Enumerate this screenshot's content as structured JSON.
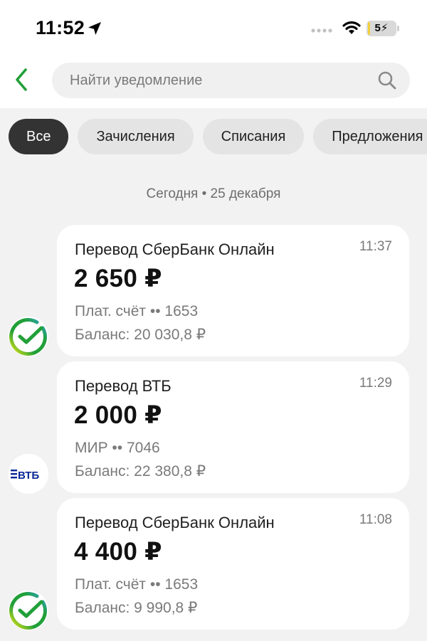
{
  "status_bar": {
    "time": "11:52",
    "battery": "5",
    "battery_level_percent": 5,
    "icons": [
      "location-arrow-icon",
      "cellular-signal-icon",
      "wifi-icon",
      "battery-icon"
    ]
  },
  "header": {
    "back_icon": "chevron-left-icon",
    "search": {
      "placeholder": "Найти уведомление",
      "value": "",
      "icon": "search-icon"
    }
  },
  "filters": [
    {
      "label": "Все",
      "active": true
    },
    {
      "label": "Зачисления",
      "active": false
    },
    {
      "label": "Списания",
      "active": false
    },
    {
      "label": "Предложения",
      "active": false
    }
  ],
  "date_header": "Сегодня • 25 декабря",
  "notifications": [
    {
      "title": "Перевод СберБанк Онлайн",
      "time": "11:37",
      "amount": "2 650 ₽",
      "line1": "Плат. счёт •• 1653",
      "line2": "Баланс: 20 030,8 ₽",
      "avatar": "sber-logo-icon"
    },
    {
      "title": "Перевод ВТБ",
      "time": "11:29",
      "amount": "2 000 ₽",
      "line1": "МИР •• 7046",
      "line2": "Баланс: 22 380,8 ₽",
      "avatar": "vtb-logo-icon",
      "avatar_text": "ВТБ"
    },
    {
      "title": "Перевод СберБанк Онлайн",
      "time": "11:08",
      "amount": "4 400 ₽",
      "line1": "Плат. счёт •• 1653",
      "line2": "Баланс: 9 990,8 ₽",
      "avatar": "sber-logo-icon"
    }
  ],
  "colors": {
    "accent_green": "#21a038",
    "chip_active_bg": "#333333",
    "chip_bg": "#e4e4e4",
    "vtb_blue": "#0a2896"
  }
}
